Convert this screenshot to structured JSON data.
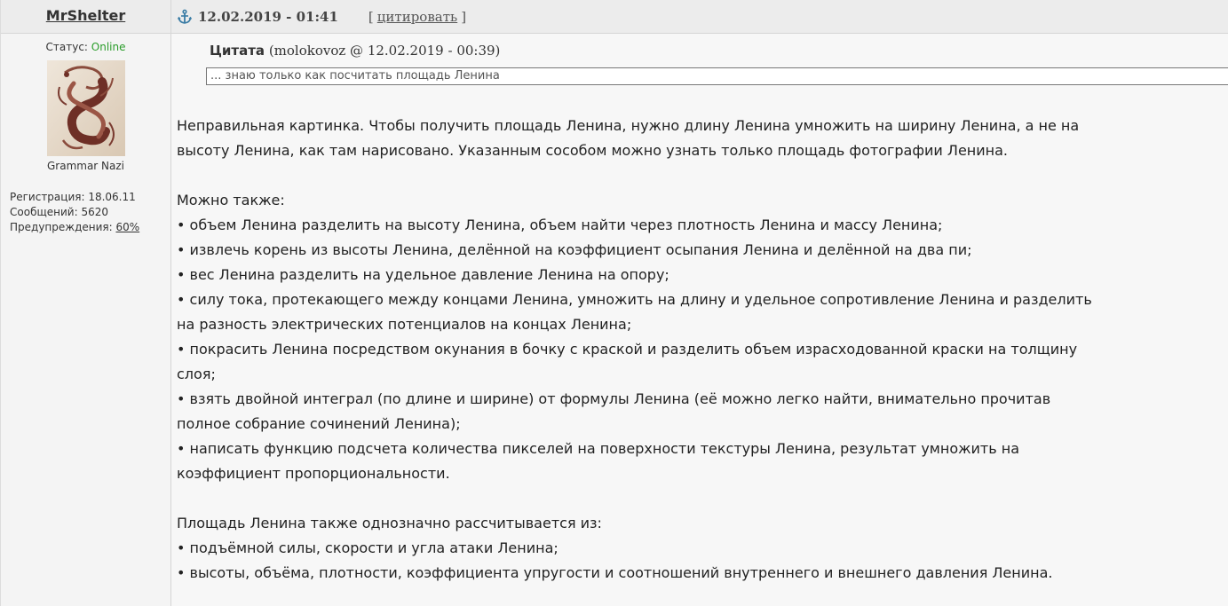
{
  "post": {
    "author": "MrShelter",
    "date": "12.02.2019 - 01:41",
    "quote_link": "цитировать",
    "bracket_open": "[",
    "bracket_close": "]"
  },
  "user": {
    "status_label": "Статус: ",
    "status_value": "Online",
    "rank": "Grammar Nazi",
    "registration": "Регистрация: 18.06.11",
    "posts": "Сообщений: 5620",
    "warnings_label": "Предупреждения: ",
    "warnings_value": "60%"
  },
  "quote": {
    "label": "Цитата",
    "source": " (molokovoz @ 12.02.2019 - 00:39)",
    "text": "... знаю только как посчитать площадь Ленина"
  },
  "content": {
    "paragraph1_line1": "Неправильная картинка. Чтобы получить площадь Ленина, нужно длину Ленина умножить на ширину Ленина, а не на",
    "paragraph1_line2": "высоту Ленина, как там нарисовано. Указанным сособом можно узнать только площадь фотографии Ленина.",
    "list1_intro": "Можно также:",
    "list1_lines": [
      "• объем Ленина разделить на высоту Ленина, объем найти через плотность Ленина и массу Ленина;",
      "• извлечь корень из высоты Ленина, делённой на коэффициент осыпания Ленина и делённой на два пи;",
      "• вес Ленина разделить на удельное давление Ленина на опору;",
      "• силу тока, протекающего между концами Ленина, умножить на длину и удельное сопротивление Ленина и разделить",
      "на разность электрических потенциалов на концах Ленина;",
      "• покрасить Ленина посредством окунания в бочку с краской и разделить объем израсходованной краски на толщину",
      "слоя;",
      "• взять двойной интеграл (по длине и ширине) от формулы Ленина (её можно легко найти, внимательно прочитав",
      "полное собрание сочинений Ленина);",
      "• написать функцию подсчета количества пикселей на поверхности текстуры Ленина, результат умножить на",
      "коэффициент пропорциональности."
    ],
    "list2_intro": "Площадь Ленина также однозначно рассчитывается из:",
    "list2_lines": [
      "• подъёмной силы, скорости и угла атаки Ленина;",
      "• высоты, объёма, плотности, коэффициента упругости и соотношений внутреннего и внешнего давления Ленина."
    ]
  },
  "colors": {
    "online": "#2a9d2a",
    "header_bg": "#ececec",
    "content_bg": "#f7f7f7",
    "anchor": "#3a7ca5"
  },
  "icons": {
    "permalink": "anchor-icon",
    "avatar": "avatar-letter-s"
  }
}
